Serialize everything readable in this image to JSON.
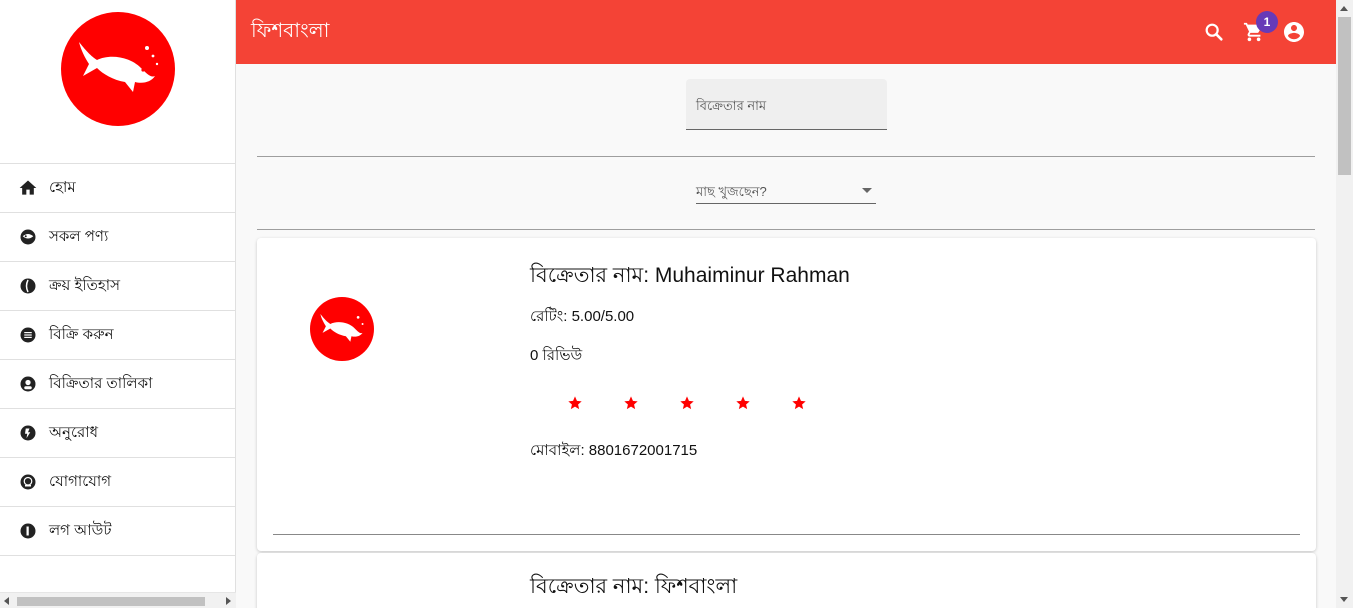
{
  "app": {
    "title": "ফিশবাংলা",
    "accent_color": "#f44336",
    "brand_color": "#ff0000",
    "badge_color": "#673ab7"
  },
  "topbar": {
    "search_icon": "search-icon",
    "cart_icon": "cart-icon",
    "cart_count": "1",
    "account_icon": "account-circle-icon"
  },
  "sidebar": {
    "items": [
      {
        "label": "হোম",
        "icon": "home-icon"
      },
      {
        "label": "সকল পণ্য",
        "icon": "products-icon"
      },
      {
        "label": "ক্রয় ইতিহাস",
        "icon": "history-icon"
      },
      {
        "label": "বিক্রি করুন",
        "icon": "list-icon"
      },
      {
        "label": "বিক্রিতার তালিকা",
        "icon": "seller-icon"
      },
      {
        "label": "অনুরোধ",
        "icon": "request-icon"
      },
      {
        "label": "যোগাযোগ",
        "icon": "contact-icon"
      },
      {
        "label": "লগ আউট",
        "icon": "logout-icon"
      }
    ]
  },
  "filters": {
    "seller_placeholder": "বিক্রেতার নাম",
    "fish_placeholder": "মাছ খুজছেন?"
  },
  "sellers": [
    {
      "name": "বিক্রেতার নাম: Muhaiminur Rahman",
      "rating": "রেটিং: 5.00/5.00",
      "reviews": "0 রিভিউ",
      "stars": 5,
      "mobile": "মোবাইল: 8801672001715"
    },
    {
      "name": "বিক্রেতার নাম: ফিশবাংলা"
    }
  ]
}
